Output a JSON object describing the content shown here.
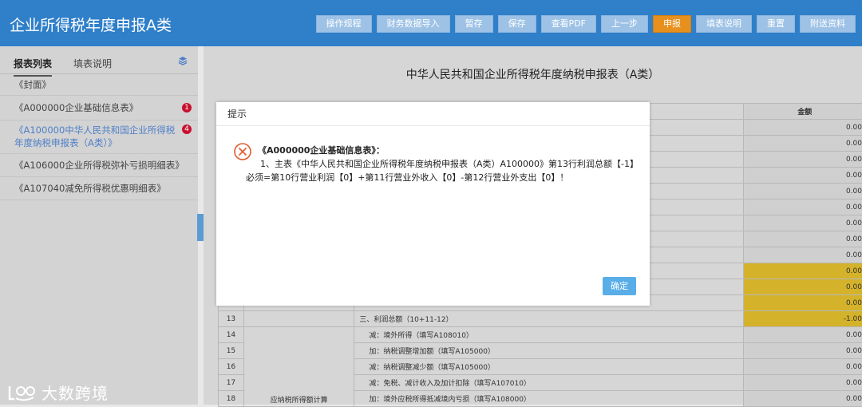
{
  "header": {
    "title": "企业所得税年度申报A类",
    "toolbar": [
      "操作规程",
      "财务数据导入",
      "暂存",
      "保存",
      "查看PDF",
      "上一步",
      "申报",
      "填表说明",
      "重置",
      "附送资料"
    ],
    "primary_index": 6
  },
  "sidebar": {
    "tabs": [
      "报表列表",
      "填表说明"
    ],
    "items": [
      {
        "label": "《封面》",
        "badge": "",
        "style": "plain"
      },
      {
        "label": "《A000000企业基础信息表》",
        "badge": "1",
        "style": "plain"
      },
      {
        "label": "《A100000中华人民共和国企业所得税年度纳税申报表（A类）》",
        "badge": "4",
        "style": "blue"
      },
      {
        "label": "《A106000企业所得税弥补亏损明细表》",
        "badge": "",
        "style": "plain"
      },
      {
        "label": "《A107040减免所得税优惠明细表》",
        "badge": "",
        "style": "plain"
      }
    ]
  },
  "main": {
    "form_title": "中华人民共和国企业所得税年度纳税申报表（A类）",
    "amount_header": "金额",
    "upper_amounts": [
      "0.00",
      "0.00",
      "0.00",
      "0.00",
      "0.00",
      "0.00",
      "0.00",
      "0.00",
      "0.00",
      "0.00",
      "0.00",
      "0.00"
    ],
    "yellow_rows": [
      9,
      10,
      11
    ],
    "rows": [
      {
        "num": "13",
        "item": "三、利润总额（10+11-12）",
        "amount": "-1.00",
        "yellow": true
      },
      {
        "num": "14",
        "item": "减：境外所得（填写A108010）",
        "amount": "0.00",
        "yellow": false
      },
      {
        "num": "15",
        "item": "加：纳税调整增加额（填写A105000）",
        "amount": "0.00",
        "yellow": false
      },
      {
        "num": "16",
        "item": "减：纳税调整减少额（填写A105000）",
        "amount": "0.00",
        "yellow": false
      },
      {
        "num": "17",
        "item": "减：免税、减计收入及加计扣除（填写A107010）",
        "amount": "0.00",
        "yellow": false
      },
      {
        "num": "18",
        "item": "加：境外应税所得抵减境内亏损（填写A108000）",
        "amount": "0.00",
        "yellow": false
      }
    ],
    "category_label": "应纳税所得额计算"
  },
  "modal": {
    "title": "提示",
    "message_title": "《A000000企业基础信息表》：",
    "message_body": "1、主表《中华人民共和国企业所得税年度纳税申报表（A类）A100000》第13行利润总额【-1】必须=第10行营业利润【0】+第11行营业外收入【0】-第12行营业外支出【0】！",
    "ok_label": "确定"
  },
  "watermark": {
    "text": "大数跨境"
  },
  "colors": {
    "header": "#2f7fc9",
    "primary": "#e8901e",
    "error": "#e05a2b",
    "ok": "#5aaee8",
    "highlight": "#d4b22a"
  }
}
